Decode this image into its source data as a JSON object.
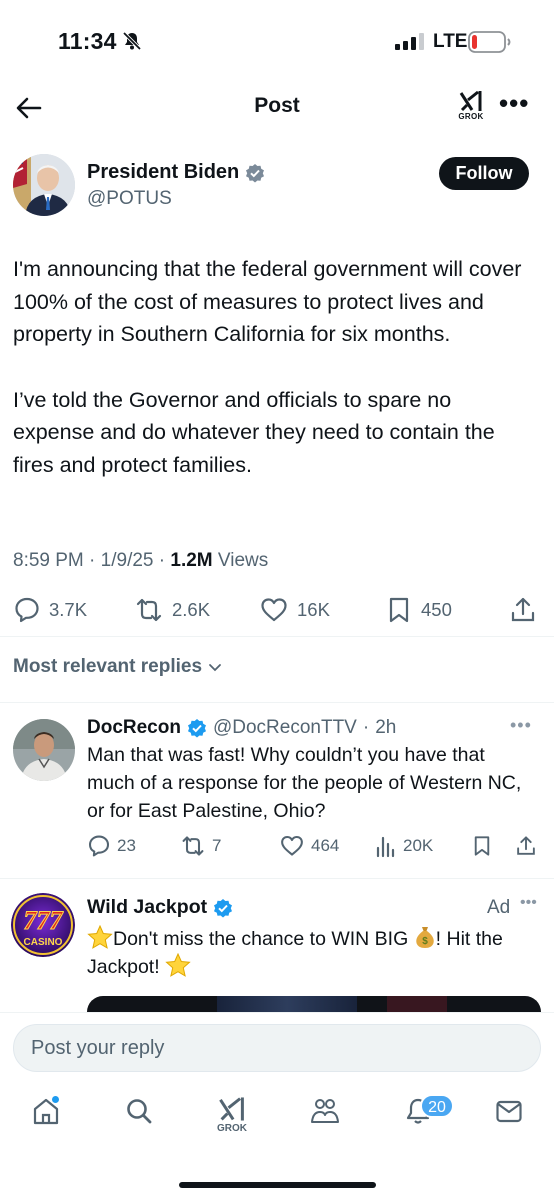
{
  "status_bar": {
    "time": "11:34",
    "network": "LTE",
    "icons": [
      "bell-slash-icon",
      "signal-icon",
      "battery-low-icon"
    ]
  },
  "header": {
    "title": "Post",
    "grok_label": "GROK",
    "icons": [
      "back-arrow-icon",
      "grok-icon",
      "more-icon"
    ]
  },
  "post": {
    "author_name": "President Biden",
    "author_handle": "@POTUS",
    "follow_label": "Follow",
    "paragraphs": [
      "I'm announcing that the federal government will cover 100% of the cost of measures to protect lives and property in Southern California for six months.",
      "I’ve told the Governor and officials to spare no expense and do whatever they need to contain the fires and protect families."
    ],
    "time": "8:59 PM",
    "date": "1/9/25",
    "views_count": "1.2M",
    "views_label": "Views",
    "stats": {
      "replies": "3.7K",
      "reposts": "2.6K",
      "likes": "16K",
      "bookmarks": "450"
    },
    "accent_color": "#1d9bf0"
  },
  "replies_filter": "Most relevant replies",
  "reply": {
    "author_name": "DocRecon",
    "author_handle": "@DocReconTTV",
    "age": "2h",
    "text": "Man that was fast! Why couldn’t you have that much of a response for the people of Western NC, or for East Palestine, Ohio?",
    "stats": {
      "replies": "23",
      "reposts": "7",
      "likes": "464",
      "views": "20K"
    }
  },
  "ad": {
    "author_name": "Wild Jackpot",
    "label": "Ad",
    "text_1": "Don't miss the chance to WIN BIG",
    "text_2": "! Hit the Jackpot!",
    "avatar_text": "777",
    "avatar_subtext": "CASINO"
  },
  "composer": {
    "placeholder": "Post your reply"
  },
  "bottom_nav": {
    "grok_label": "GROK",
    "notifications_badge": "20",
    "items": [
      "home-icon",
      "search-icon",
      "grok-icon",
      "communities-icon",
      "notifications-icon",
      "messages-icon"
    ]
  }
}
